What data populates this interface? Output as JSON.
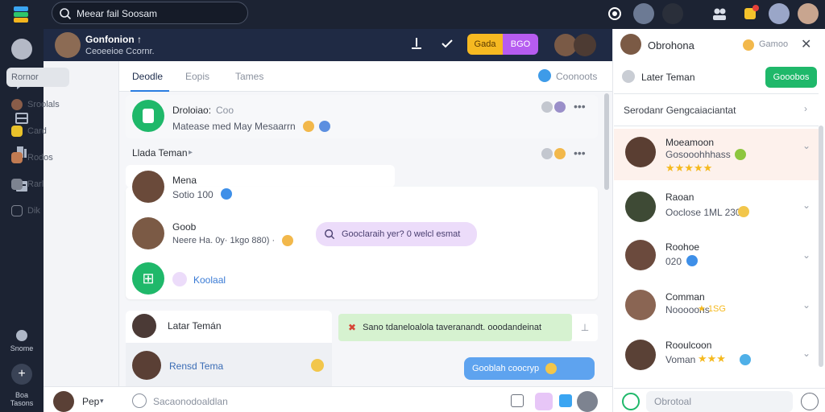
{
  "topbar": {
    "search_text": "Meear fail Soosam"
  },
  "chat_header": {
    "title": "Gonfonion ↑",
    "subtitle": "Ceoeeioe Ccornr.",
    "badge_orange": "Gada",
    "badge_purple": "BGO"
  },
  "rail": {
    "label_1": "Snome",
    "label_2": "Boa\nTasons"
  },
  "nav": {
    "items": [
      {
        "label": "Rornor"
      },
      {
        "label": "Sroolals"
      },
      {
        "label": "Card"
      },
      {
        "label": "Rodos"
      },
      {
        "label": "Rarl"
      },
      {
        "label": "Dik"
      }
    ]
  },
  "tabs": [
    {
      "label": "Deodle"
    },
    {
      "label": "Eopis"
    },
    {
      "label": "Tames"
    }
  ],
  "tabs_right": "Coonoots",
  "thread_top": {
    "name": "Droloiao:",
    "name_extra": "Coo",
    "message": "Matease med  May Mesaarrn"
  },
  "section_title": "Llada Teman",
  "contacts": [
    {
      "name": "Mena",
      "detail": "Sotio 100"
    },
    {
      "name": "Goob",
      "detail": "Neere Ha. 0y· 1kgo 880) ·"
    },
    {
      "name": "",
      "detail": "Koolaal"
    }
  ],
  "search_pill": "Gooclaraih yer? 0 welcl esmat",
  "later_card": {
    "title": "Latar Temán",
    "row": "Rensd Tema"
  },
  "green_banner": "Sano tdaneloalola taveranandt. ooodandeinat",
  "blue_pill": "Gooblah coocryp",
  "composer": {
    "user": "Pep",
    "placeholder": "Sacaonodoaldlan"
  },
  "right_panel": {
    "title": "Obrohona",
    "subtitle_link": "Gamoo",
    "later_label": "Later Teman",
    "green_button": "Gooobos",
    "section": "Serodanr Gengcaiaciantat",
    "people": [
      {
        "name": "Moeamoon",
        "detail": "Gosooohhhass",
        "stars": "★★★★★"
      },
      {
        "name": "Raoan",
        "detail": "Ooclose 1ML 230",
        "stars": ""
      },
      {
        "name": "Roohoe",
        "detail": "020",
        "stars": ""
      },
      {
        "name": "Comman",
        "detail": "Nooooons",
        "stars": "★ 1SG"
      },
      {
        "name": "Rooulcoon",
        "detail": "Voman",
        "stars": "★★★"
      }
    ],
    "footer_input": "Obrotoal"
  }
}
